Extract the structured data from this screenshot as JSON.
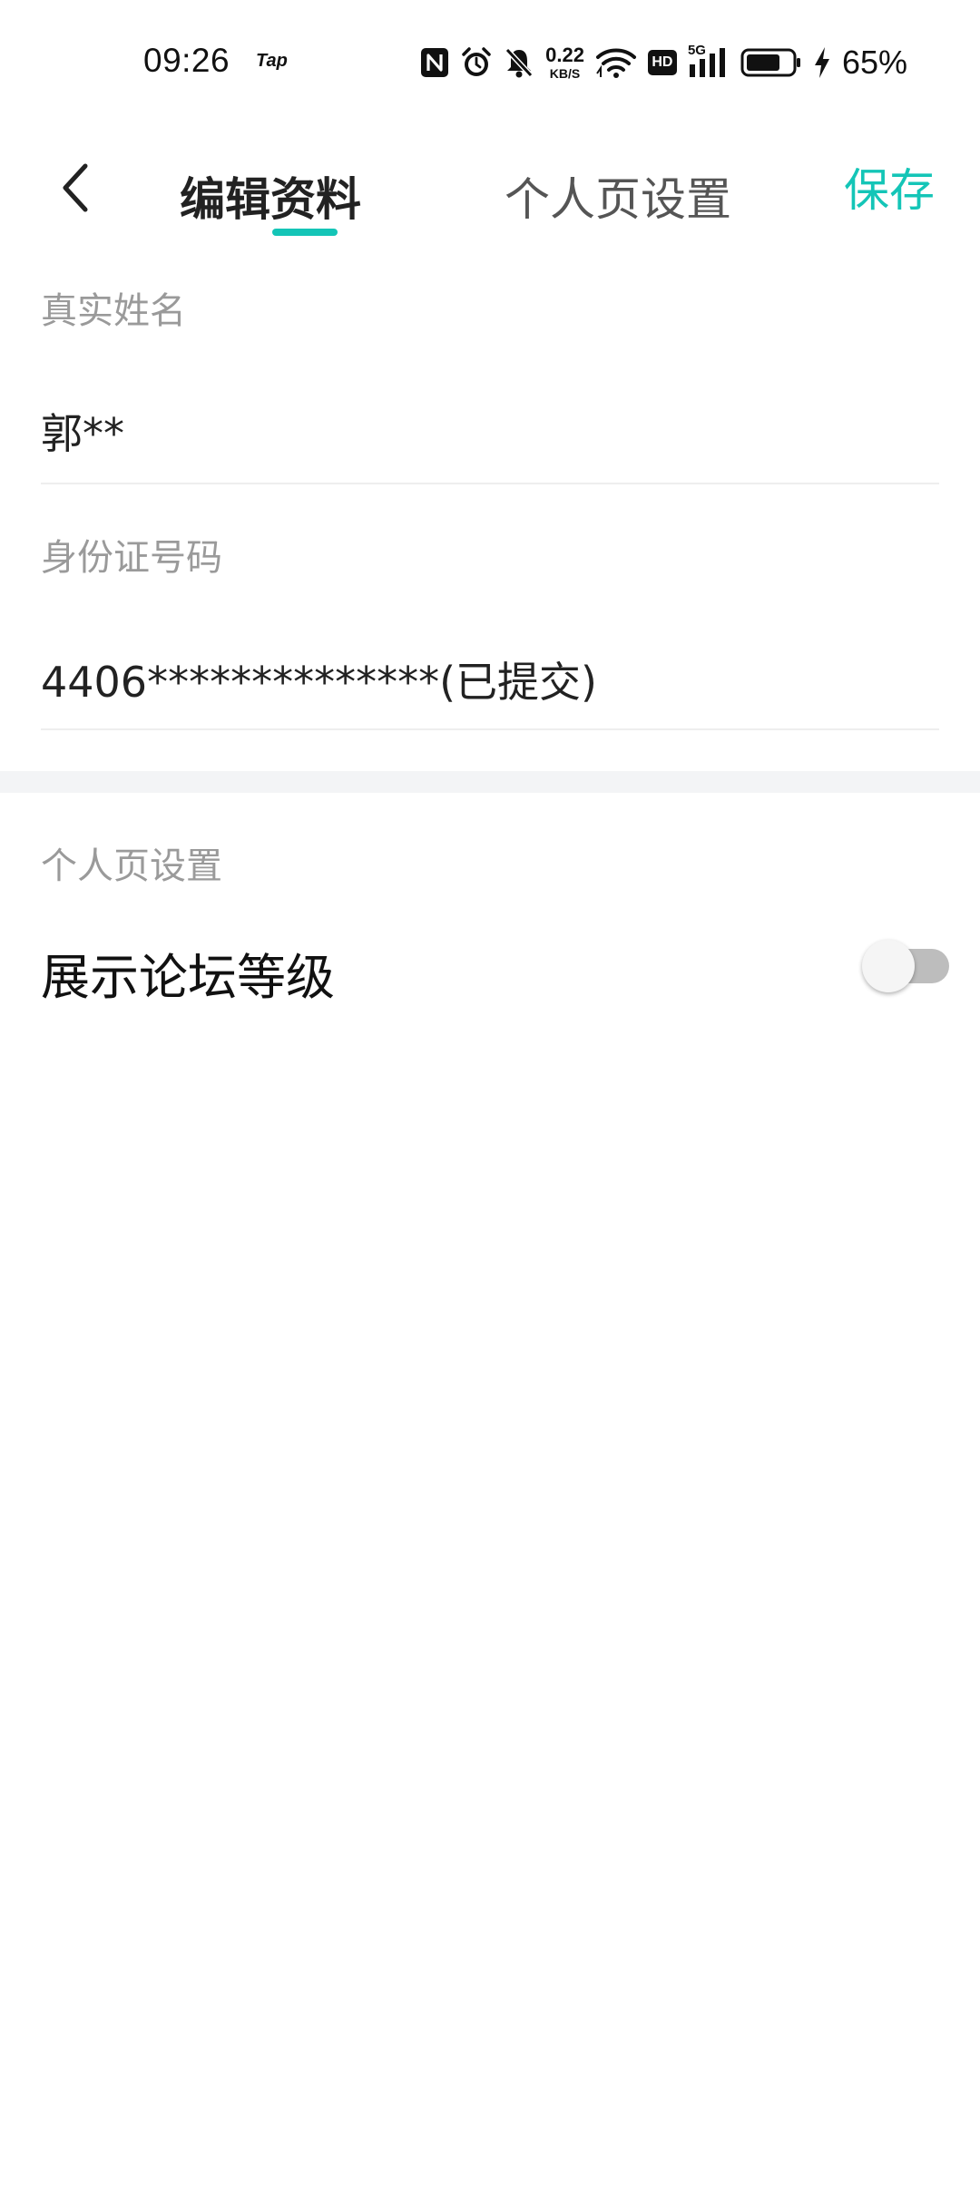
{
  "status_bar": {
    "time": "09:26",
    "app_badge": "Tap",
    "net_speed_value": "0.22",
    "net_speed_unit": "KB/S",
    "hd_label": "HD",
    "network_type": "5G",
    "battery_percent": "65%",
    "icons": [
      "nfc-icon",
      "alarm-icon",
      "mute-bell-icon",
      "wifi-icon",
      "hd-icon",
      "signal-icon",
      "battery-icon",
      "charging-icon"
    ]
  },
  "header": {
    "back_icon": "chevron-left-icon",
    "tabs": [
      {
        "label": "编辑资料",
        "active": true
      },
      {
        "label": "个人页设置",
        "active": false
      }
    ],
    "save_label": "保存",
    "accent_color": "#14c5b7"
  },
  "form": {
    "real_name": {
      "label": "真实姓名",
      "value": "郭**"
    },
    "id_number": {
      "label": "身份证号码",
      "value": "4406**************(已提交)"
    }
  },
  "personal_settings": {
    "section_label": "个人页设置",
    "items": [
      {
        "label": "展示论坛等级",
        "enabled": false
      }
    ]
  }
}
